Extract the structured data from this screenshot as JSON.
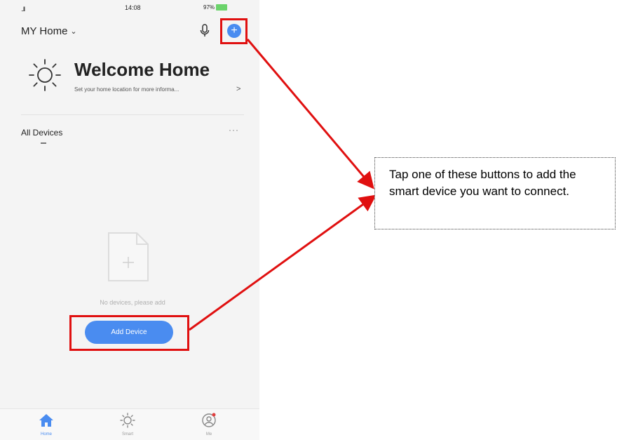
{
  "status_bar": {
    "signal": "..ll",
    "wifi": "wifi-icon",
    "time": "14:08",
    "battery_pct": "97%"
  },
  "header": {
    "home_name": "MY Home",
    "chevron": "⌄"
  },
  "welcome": {
    "title": "Welcome Home",
    "subtitle": "Set your home location for more informa...",
    "arrow": ">"
  },
  "devices": {
    "section_title": "All Devices",
    "more": "···",
    "empty_text": "No devices, please add",
    "add_button": "Add Device"
  },
  "tabs": [
    {
      "label": "Home",
      "icon": "home-icon"
    },
    {
      "label": "Smart",
      "icon": "sun-icon"
    },
    {
      "label": "Me",
      "icon": "profile-icon"
    }
  ],
  "callout": {
    "text": "Tap one of these buttons to add the smart device you want to connect."
  },
  "colors": {
    "accent": "#4a8cf0",
    "annotation_red": "#e01010"
  }
}
